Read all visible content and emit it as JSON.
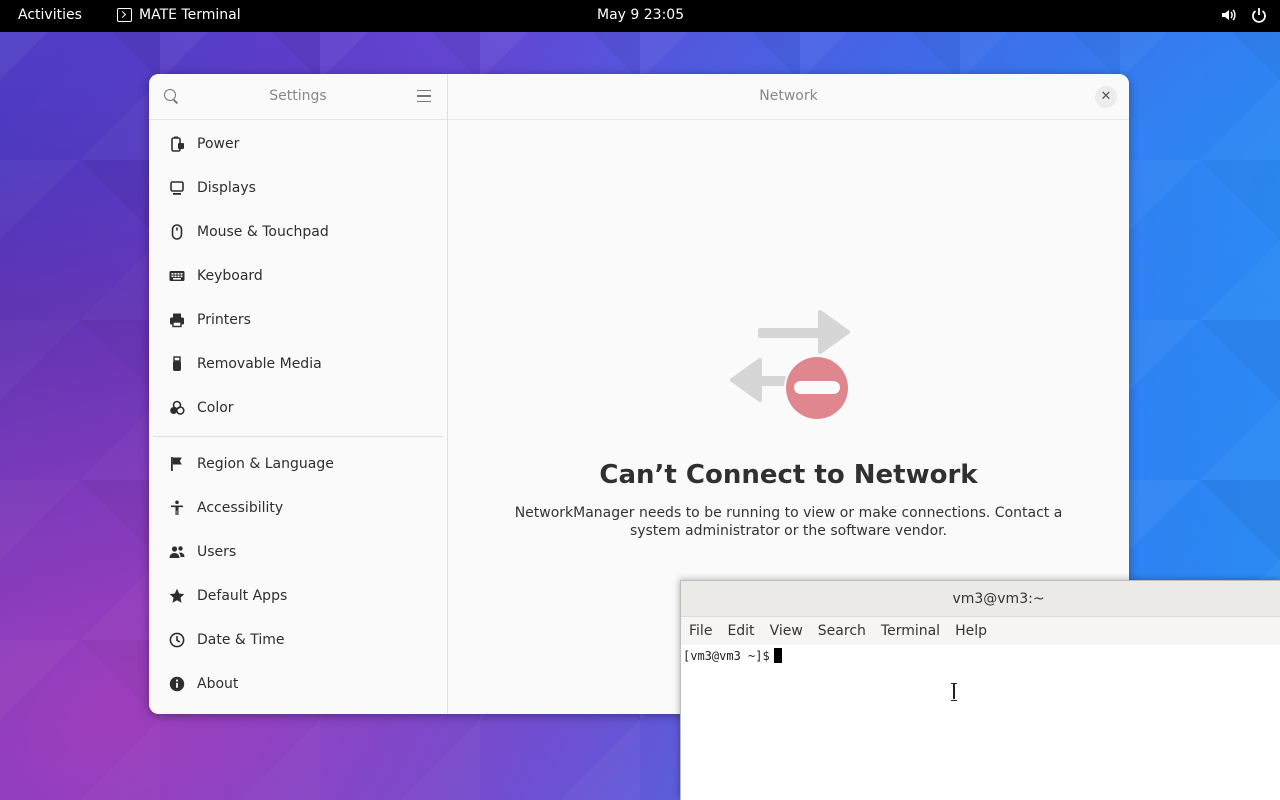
{
  "topbar": {
    "activities": "Activities",
    "app_name": "MATE Terminal",
    "clock": "May 9  23:05",
    "tray": [
      "volume-icon",
      "power-icon"
    ]
  },
  "settings": {
    "sidebar_title": "Settings",
    "main_title": "Network",
    "items_group1": [
      {
        "label": "Power",
        "icon": "power-battery-icon"
      },
      {
        "label": "Displays",
        "icon": "display-icon"
      },
      {
        "label": "Mouse & Touchpad",
        "icon": "mouse-icon"
      },
      {
        "label": "Keyboard",
        "icon": "keyboard-icon"
      },
      {
        "label": "Printers",
        "icon": "printer-icon"
      },
      {
        "label": "Removable Media",
        "icon": "usb-icon"
      },
      {
        "label": "Color",
        "icon": "color-icon"
      }
    ],
    "items_group2": [
      {
        "label": "Region & Language",
        "icon": "flag-icon"
      },
      {
        "label": "Accessibility",
        "icon": "accessibility-icon"
      },
      {
        "label": "Users",
        "icon": "users-icon"
      },
      {
        "label": "Default Apps",
        "icon": "star-icon"
      },
      {
        "label": "Date & Time",
        "icon": "clock-icon"
      },
      {
        "label": "About",
        "icon": "info-icon"
      }
    ],
    "empty_state": {
      "heading": "Can’t Connect to Network",
      "message": "NetworkManager needs to be running to view or make connections. Contact a system administrator or the software vendor.",
      "icon": "network-disconnected-icon"
    }
  },
  "terminal": {
    "title": "vm3@vm3:~",
    "menu": [
      "File",
      "Edit",
      "View",
      "Search",
      "Terminal",
      "Help"
    ],
    "prompt": "[vm3@vm3 ~]$"
  },
  "colors": {
    "topbar_bg": "#000000",
    "window_bg": "#fafafa",
    "error_red": "#e0868f",
    "arrow_gray": "#d6d6d6"
  }
}
